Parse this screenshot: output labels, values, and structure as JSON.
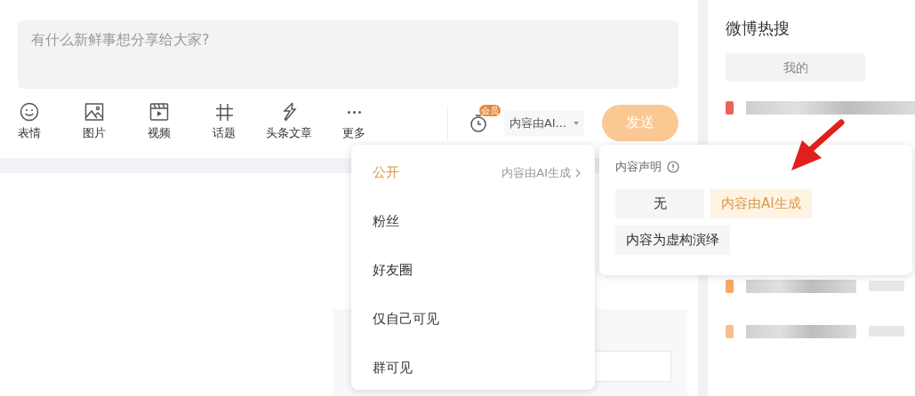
{
  "composer": {
    "placeholder": "有什么新鲜事想分享给大家?"
  },
  "toolbar": [
    {
      "kind": "emoji",
      "label": "表情"
    },
    {
      "kind": "image",
      "label": "图片"
    },
    {
      "kind": "video",
      "label": "视频"
    },
    {
      "kind": "topic",
      "label": "话题"
    },
    {
      "kind": "article",
      "label": "头条文章"
    },
    {
      "kind": "more",
      "label": "更多"
    }
  ],
  "schedule_badge": "会员",
  "declaration_dropdown": {
    "value": "内容由AI..."
  },
  "send_button": {
    "label": "发送",
    "disabled": true
  },
  "visibility_menu": [
    {
      "label": "公开",
      "selected": true,
      "hint": "内容由AI生成"
    },
    {
      "label": "粉丝",
      "selected": false
    },
    {
      "label": "好友圈",
      "selected": false
    },
    {
      "label": "仅自己可见",
      "selected": false
    },
    {
      "label": "群可见",
      "selected": false
    }
  ],
  "declaration_popup": {
    "title": "内容声明",
    "options": [
      {
        "label": "无",
        "selected": false
      },
      {
        "label": "内容由AI生成",
        "selected": true
      },
      {
        "label": "内容为虚构演绎",
        "selected": false
      }
    ]
  },
  "sidebar": {
    "title": "微博热搜",
    "tabs": [
      {
        "label": "我的",
        "selected": true
      }
    ],
    "hot_rows": [
      {
        "color": "#e9625c"
      },
      {
        "color": "#f4a862"
      },
      {
        "color": "#f7c08a"
      }
    ]
  }
}
